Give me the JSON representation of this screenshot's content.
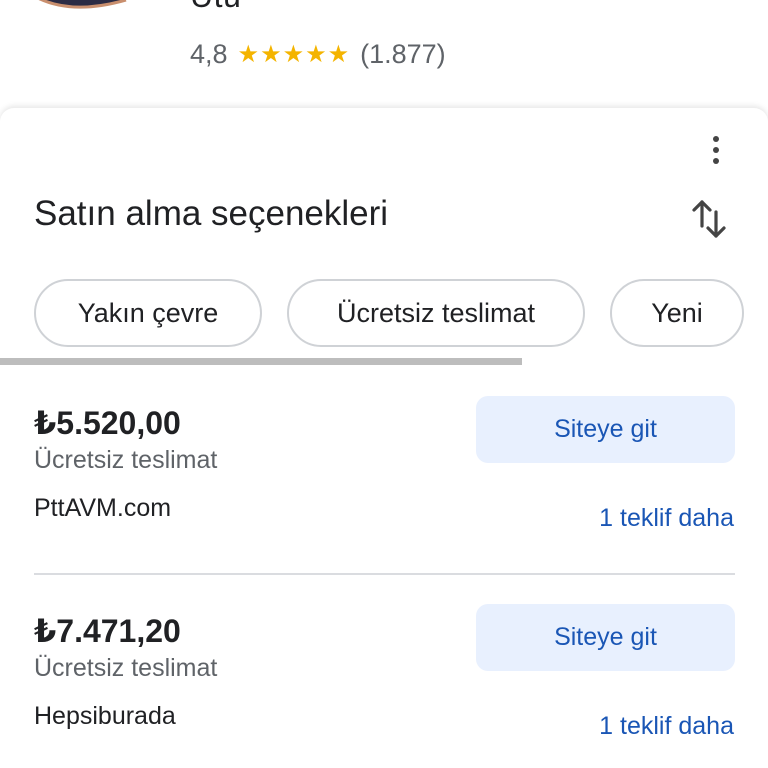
{
  "product": {
    "title": "Ütü",
    "rating": "4,8",
    "stars": "★★★★★",
    "review_count": "(1.877)"
  },
  "purchase": {
    "section_title": "Satın alma seçenekleri",
    "more_icon": "more-vert-icon",
    "sort_icon": "swap-vert-icon",
    "chips": [
      {
        "label": "Yakın çevre"
      },
      {
        "label": "Ücretsiz teslimat"
      },
      {
        "label": "Yeni"
      }
    ],
    "offers": [
      {
        "price": "₺5.520,00",
        "shipping": "Ücretsiz teslimat",
        "seller": "PttAVM.com",
        "button_label": "Siteye git",
        "more_offers": "1 teklif daha"
      },
      {
        "price": "₺7.471,20",
        "shipping": "Ücretsiz teslimat",
        "seller": "Hepsiburada",
        "button_label": "Siteye git",
        "more_offers": "1 teklif daha"
      }
    ]
  },
  "colors": {
    "accent": "#1a56b5",
    "button_bg": "#e8f0fe",
    "star": "#f4b400"
  }
}
